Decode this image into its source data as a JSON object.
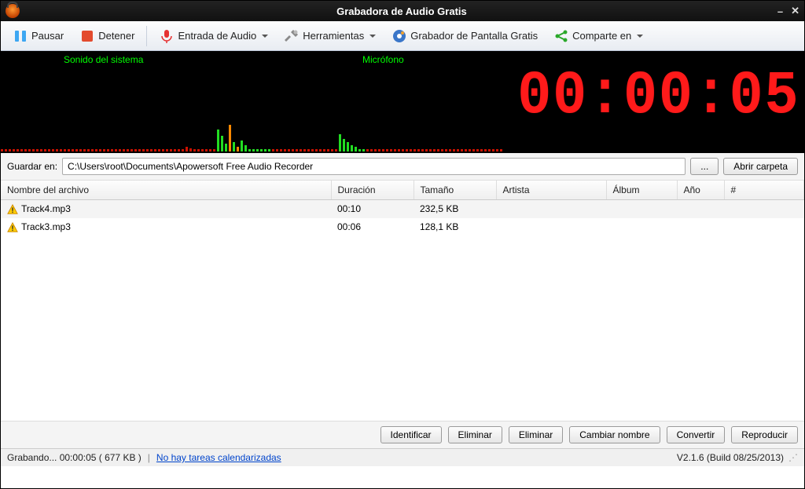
{
  "window": {
    "title": "Grabadora de Audio Gratis"
  },
  "toolbar": {
    "pause": "Pausar",
    "stop": "Detener",
    "audio_input": "Entrada de Audio",
    "tools": "Herramientas",
    "screen_recorder": "Grabador de Pantalla Gratis",
    "share": "Comparte en"
  },
  "visualizer": {
    "system_sound": "Sonido del sistema",
    "microphone": "Micrófono",
    "timer": "00:00:05"
  },
  "save": {
    "label": "Guardar en:",
    "path": "C:\\Users\\root\\Documents\\Apowersoft Free Audio Recorder",
    "browse": "...",
    "open_folder": "Abrir carpeta"
  },
  "columns": {
    "filename": "Nombre del archivo",
    "duration": "Duración",
    "size": "Tamaño",
    "artist": "Artista",
    "album": "Álbum",
    "year": "Año",
    "track": "#"
  },
  "rows": [
    {
      "filename": "Track4.mp3",
      "duration": "00:10",
      "size": "232,5 KB",
      "artist": "",
      "album": "",
      "year": "",
      "track": ""
    },
    {
      "filename": "Track3.mp3",
      "duration": "00:06",
      "size": "128,1 KB",
      "artist": "",
      "album": "",
      "year": "",
      "track": ""
    }
  ],
  "actions": {
    "identify": "Identificar",
    "delete1": "Eliminar",
    "delete2": "Eliminar",
    "rename": "Cambiar nombre",
    "convert": "Convertir",
    "play": "Reproducir"
  },
  "status": {
    "recording": "Grabando... 00:00:05 ( 677 KB )",
    "separator": "|",
    "no_tasks": "No hay tareas calendarizadas",
    "version": "V2.1.6 (Build 08/25/2013)"
  }
}
